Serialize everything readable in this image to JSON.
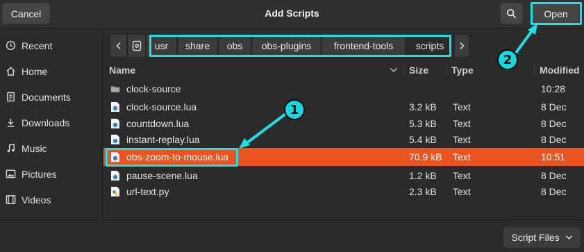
{
  "header": {
    "title": "Add Scripts",
    "cancel_label": "Cancel",
    "open_label": "Open",
    "search_icon": "search-icon"
  },
  "sidebar": {
    "items": [
      {
        "label": "Recent",
        "icon": "clock-icon"
      },
      {
        "label": "Home",
        "icon": "home-icon"
      },
      {
        "label": "Documents",
        "icon": "document-icon"
      },
      {
        "label": "Downloads",
        "icon": "download-icon"
      },
      {
        "label": "Music",
        "icon": "music-icon"
      },
      {
        "label": "Pictures",
        "icon": "picture-icon"
      },
      {
        "label": "Videos",
        "icon": "video-icon"
      }
    ]
  },
  "pathbar": {
    "segments": [
      "usr",
      "share",
      "obs",
      "obs-plugins",
      "frontend-tools",
      "scripts"
    ]
  },
  "list": {
    "columns": {
      "name": "Name",
      "size": "Size",
      "type": "Type",
      "modified": "Modified"
    },
    "rows": [
      {
        "name": "clock-source",
        "size": "",
        "type": "",
        "modified": "10:28",
        "kind": "folder"
      },
      {
        "name": "clock-source.lua",
        "size": "3.2 kB",
        "type": "Text",
        "modified": "8 Dec",
        "kind": "lua"
      },
      {
        "name": "countdown.lua",
        "size": "5.3 kB",
        "type": "Text",
        "modified": "8 Dec",
        "kind": "lua"
      },
      {
        "name": "instant-replay.lua",
        "size": "5.4 kB",
        "type": "Text",
        "modified": "8 Dec",
        "kind": "lua"
      },
      {
        "name": "obs-zoom-to-mouse.lua",
        "size": "70.9 kB",
        "type": "Text",
        "modified": "10:51",
        "kind": "lua",
        "selected": true
      },
      {
        "name": "pause-scene.lua",
        "size": "1.2 kB",
        "type": "Text",
        "modified": "8 Dec",
        "kind": "lua"
      },
      {
        "name": "url-text.py",
        "size": "2.3 kB",
        "type": "Text",
        "modified": "8 Dec",
        "kind": "py"
      }
    ]
  },
  "footer": {
    "filter_label": "Script Files"
  },
  "annotations": {
    "badge1": "1",
    "badge2": "2"
  },
  "colors": {
    "accent": "#e95420",
    "highlight": "#1ee0e8"
  }
}
